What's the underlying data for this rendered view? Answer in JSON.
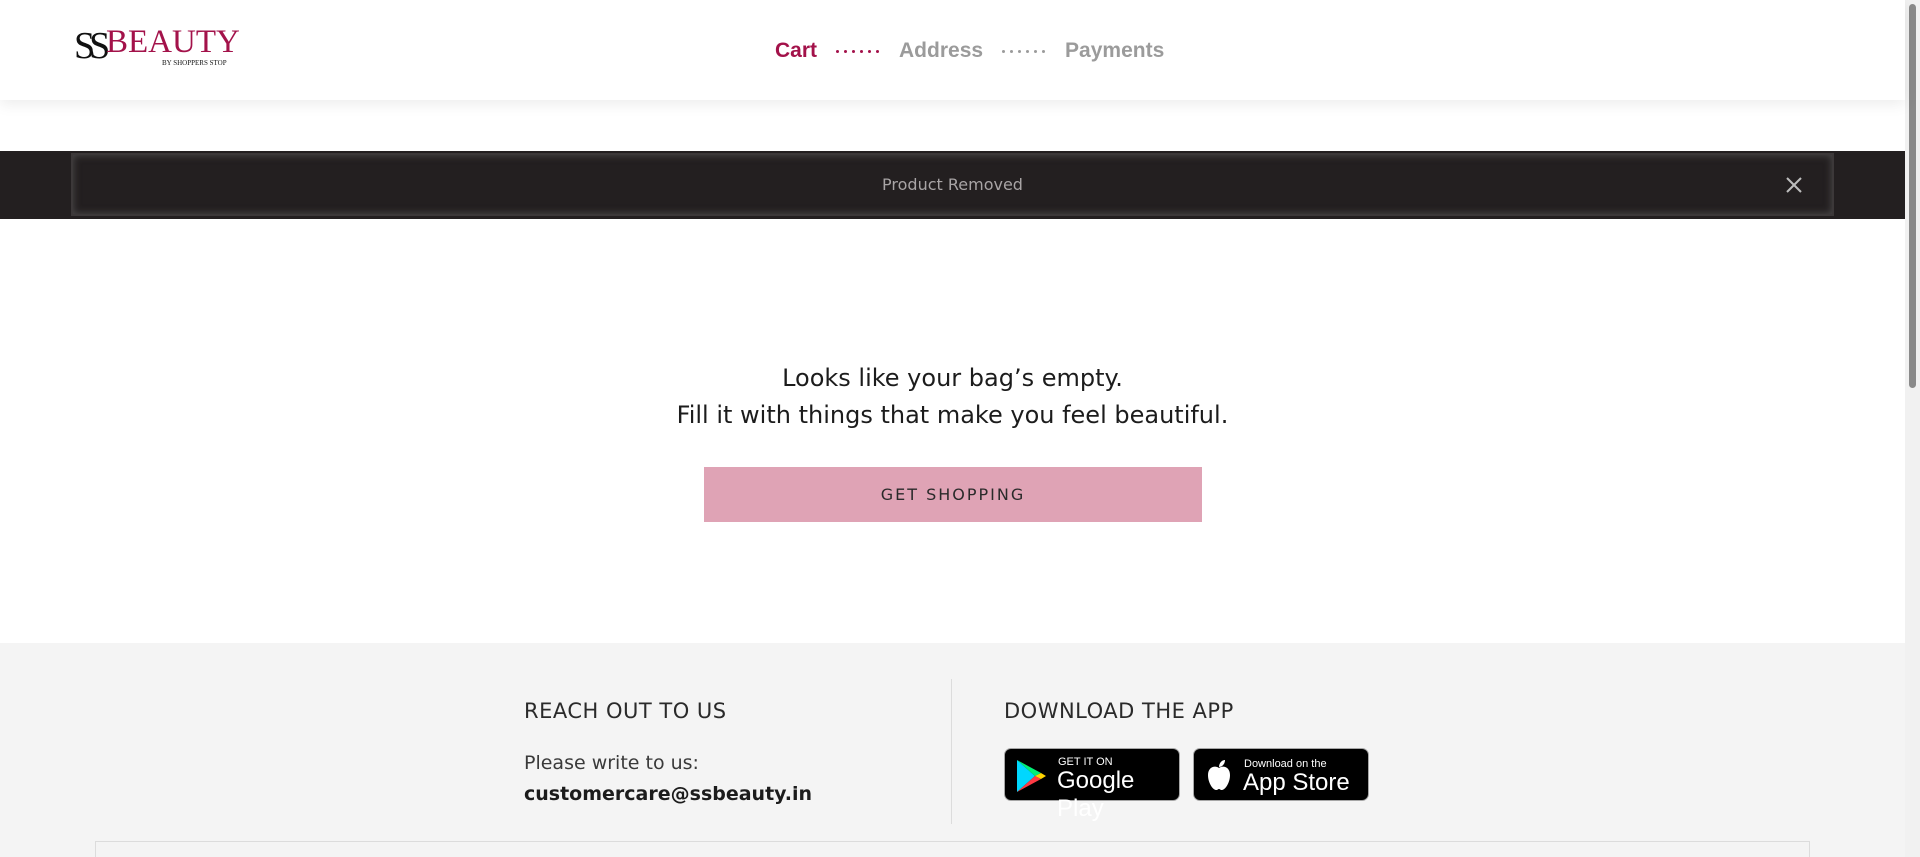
{
  "header": {
    "logo_text": "SSBEAUTY",
    "logo_sub": "BY SHOPPERS STOP",
    "steps": [
      {
        "label": "Cart",
        "state": "active"
      },
      {
        "label": "Address",
        "state": "inactive"
      },
      {
        "label": "Payments",
        "state": "inactive"
      }
    ]
  },
  "toast": {
    "message": "Product Removed",
    "close_icon": "close-icon"
  },
  "empty_bag": {
    "line1": "Looks like your bag’s empty.",
    "line2": "Fill it with things that make you feel beautiful.",
    "button_label": "GET SHOPPING"
  },
  "footer": {
    "reach_title": "REACH OUT TO US",
    "write_label": "Please write to us:",
    "email": "customercare@ssbeauty.in",
    "download_title": "DOWNLOAD THE APP",
    "google_play": {
      "small": "GET IT ON",
      "big": "Google Play"
    },
    "app_store": {
      "small": "Download on the",
      "big": "App Store"
    }
  },
  "colors": {
    "brand": "#a3124a",
    "inactive": "#9b9b9b",
    "button": "#dfa3b5",
    "toast_bg": "#231f20",
    "footer_bg": "#f4f4f4"
  }
}
